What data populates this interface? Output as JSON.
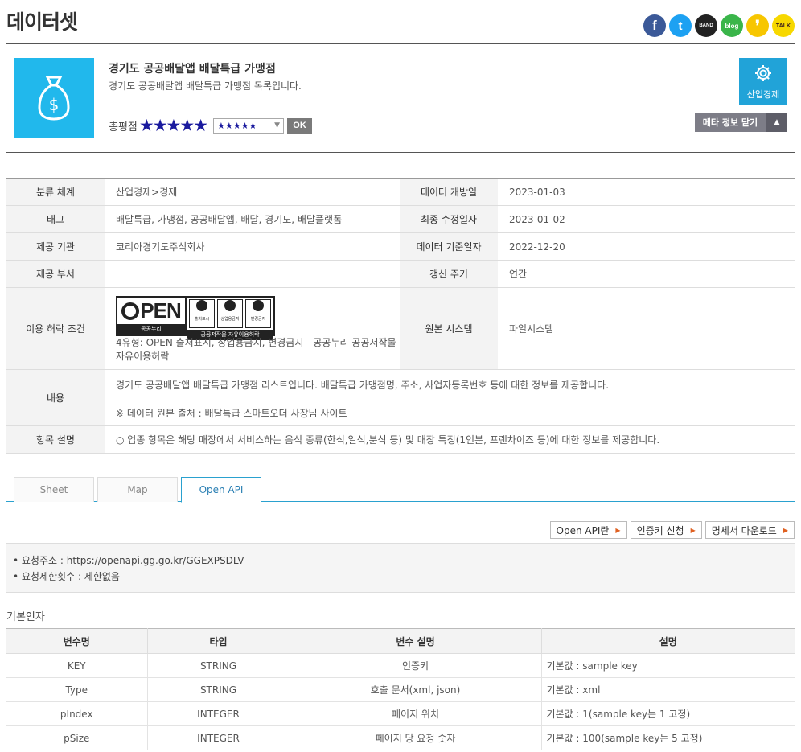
{
  "page": {
    "title": "데이터셋"
  },
  "share": [
    {
      "name": "facebook-icon",
      "glyph": "f",
      "color": "#3b5998"
    },
    {
      "name": "twitter-icon",
      "glyph": "t",
      "color": "#1da1f2"
    },
    {
      "name": "band-icon",
      "glyph": "BAND",
      "color": "#222222"
    },
    {
      "name": "blog-icon",
      "glyph": "blog",
      "color": "#3ab54a"
    },
    {
      "name": "kakaostory-icon",
      "glyph": "❜",
      "color": "#f7c600"
    },
    {
      "name": "kakaotalk-icon",
      "glyph": "TALK",
      "color": "#f7d800"
    }
  ],
  "dataset": {
    "title": "경기도 공공배달앱 배달특급 가맹점",
    "description": "경기도 공공배달앱 배달특급 가맹점 목록입니다.",
    "rating_label": "총평점",
    "stars": "★★★★★",
    "rate_select": "★★★★★",
    "ok": "OK",
    "category_button": "산업경제",
    "meta_button": "메타 정보 닫기"
  },
  "info": {
    "category_label": "분류 체계",
    "category": "산업경제>경제",
    "open_date_label": "데이터 개방일",
    "open_date": "2023-01-03",
    "tags_label": "태그",
    "tags": [
      "배달특급",
      "가맹점",
      "공공배달앱",
      "배달",
      "경기도",
      "배달플랫폼"
    ],
    "modified_label": "최종 수정일자",
    "modified": "2023-01-02",
    "provider_label": "제공 기관",
    "provider": "코리아경기도주식회사",
    "base_date_label": "데이터 기준일자",
    "base_date": "2022-12-20",
    "dept_label": "제공 부서",
    "dept": "",
    "cycle_label": "갱신 주기",
    "cycle": "연간",
    "license_label": "이용 허락 조건",
    "license_text": "4유형: OPEN 출처표시, 상업용금지, 변경금지 - 공공누리 공공저작물 자유이용허락",
    "license_open": "PEN",
    "license_nuri": "공공누리",
    "license_free": "공공저작물 자유이용허락",
    "license_icons": [
      "출처표시",
      "상업용금지",
      "변경금지"
    ],
    "source_label": "원본 시스템",
    "source": "파일시스템",
    "content_label": "내용",
    "content_line1": "경기도 공공배달앱 배달특급 가맹점 리스트입니다. 배달특급 가맹점명, 주소, 사업자등록번호 등에 대한 정보를 제공합니다.",
    "content_line2": "※ 데이터 원본 출처 : 배달특급 스마트오더 사장님 사이트",
    "items_label": "항목 설명",
    "items": "○ 업종 항목은 해당 매장에서 서비스하는 음식 종류(한식,일식,분식 등) 및 매장 특징(1인분, 프랜차이즈 등)에 대한 정보를 제공합니다."
  },
  "tabs": [
    "Sheet",
    "Map",
    "Open API"
  ],
  "api_buttons": [
    "Open API란",
    "인증키 신청",
    "명세서 다운로드"
  ],
  "request": {
    "url": "• 요청주소 : https://openapi.gg.go.kr/GGEXPSDLV",
    "limit": "• 요청제한횟수 : 제한없음"
  },
  "params": {
    "title": "기본인자",
    "headers": [
      "변수명",
      "타입",
      "변수 설명",
      "설명"
    ],
    "rows": [
      [
        "KEY",
        "STRING",
        "인증키",
        "기본값 : sample key"
      ],
      [
        "Type",
        "STRING",
        "호출 문서(xml, json)",
        "기본값 : xml"
      ],
      [
        "pIndex",
        "INTEGER",
        "페이지 위치",
        "기본값 : 1(sample key는 1 고정)"
      ],
      [
        "pSize",
        "INTEGER",
        "페이지 당 요청 숫자",
        "기본값 : 100(sample key는 5 고정)"
      ]
    ]
  }
}
